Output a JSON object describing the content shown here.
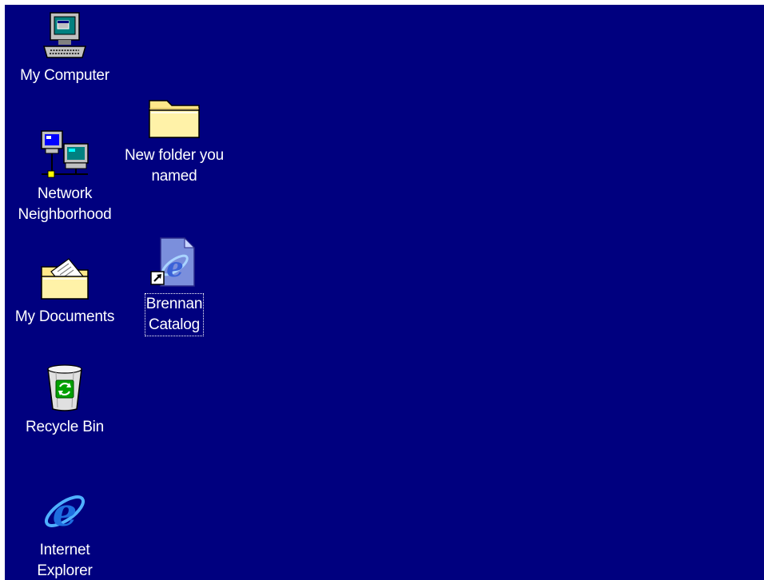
{
  "desktop": {
    "background_color": "#00007f",
    "icons": [
      {
        "label": "My Computer",
        "icon": "computer-icon"
      },
      {
        "label": "Network\nNeighborhood",
        "icon": "network-icon"
      },
      {
        "label": "My Documents",
        "icon": "documents-folder-icon"
      },
      {
        "label": "Recycle Bin",
        "icon": "recycle-bin-icon"
      },
      {
        "label": "Internet\nExplorer",
        "icon": "internet-explorer-icon"
      },
      {
        "label": "New folder you\nnamed",
        "icon": "folder-icon"
      },
      {
        "label": "Brennan\nCatalog",
        "icon": "ie-shortcut-icon",
        "focused": true
      }
    ]
  }
}
